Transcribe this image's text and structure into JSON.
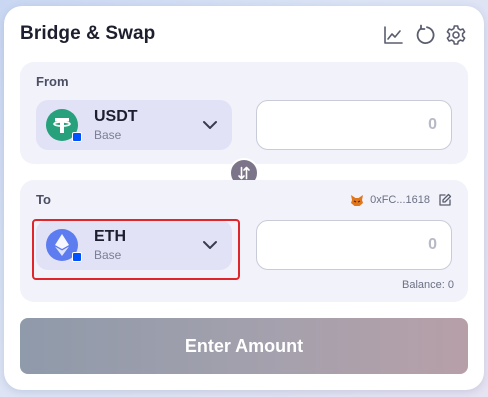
{
  "header": {
    "title": "Bridge & Swap",
    "icons": [
      "chart-icon",
      "refresh-icon",
      "settings-icon"
    ]
  },
  "from": {
    "label": "From",
    "token": {
      "symbol": "USDT",
      "chain": "Base",
      "logo_color": "#26a17b"
    },
    "amount": {
      "value": "",
      "placeholder": "0"
    }
  },
  "to": {
    "label": "To",
    "wallet_address": "0xFC...1618",
    "token": {
      "symbol": "ETH",
      "chain": "Base",
      "logo_color": "#5c7cf0"
    },
    "amount": {
      "value": "",
      "placeholder": "0"
    },
    "balance": "Balance: 0"
  },
  "cta": {
    "label": "Enter Amount"
  },
  "colors": {
    "chain_badge": "#0052ff",
    "highlight": "#e0252b",
    "swap_button": "#7c7589"
  }
}
